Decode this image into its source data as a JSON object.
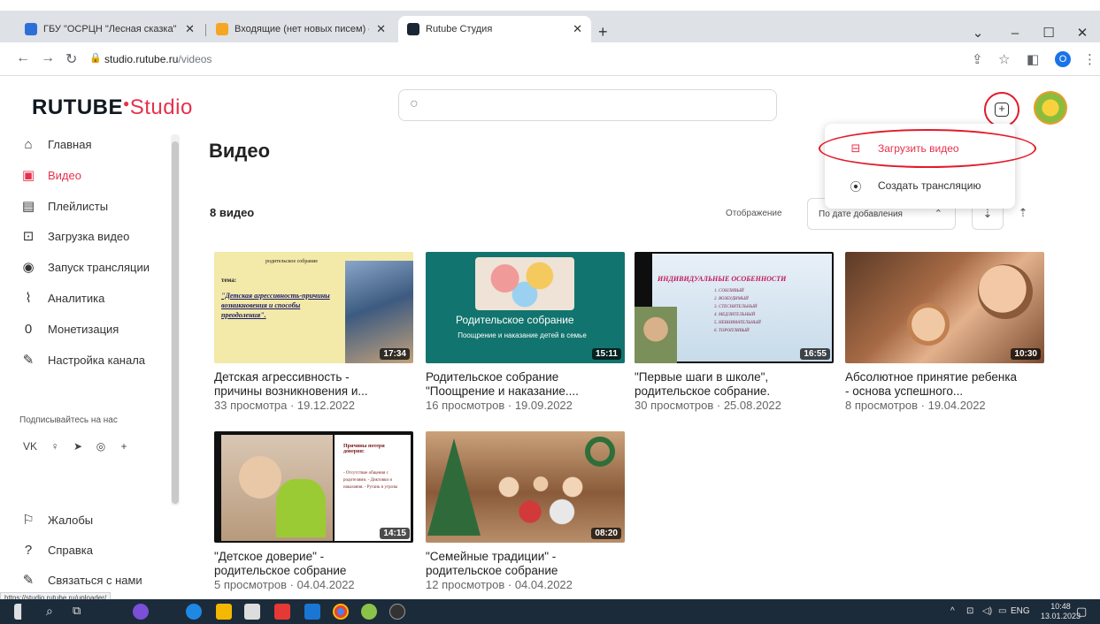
{
  "browser": {
    "tabs": [
      {
        "label": "ГБУ \"ОСРЦН \"Лесная сказка\" (п",
        "favicon_color": "#2d6fd9"
      },
      {
        "label": "Входящие (нет новых писем) —",
        "favicon_color": "#f5a623"
      },
      {
        "label": "Rutube Студия",
        "favicon_color": "#1a2633"
      }
    ],
    "url_host": "studio.rutube.ru",
    "url_path": "/videos",
    "profile_initial": "O",
    "status_url": "https://studio.rutube.ru/uploader/"
  },
  "header": {
    "logo_main": "RUTUBE",
    "logo_studio": "Studio",
    "search_placeholder": ""
  },
  "upload_menu": {
    "items": [
      {
        "label": "Загрузить видео",
        "icon": "upload-video-icon"
      },
      {
        "label": "Создать трансляцию",
        "icon": "broadcast-icon"
      }
    ]
  },
  "sidebar": {
    "items": [
      {
        "label": "Главная",
        "icon": "home-icon"
      },
      {
        "label": "Видео",
        "icon": "video-icon",
        "active": true
      },
      {
        "label": "Плейлисты",
        "icon": "playlist-icon"
      },
      {
        "label": "Загрузка видео",
        "icon": "upload-icon"
      },
      {
        "label": "Запуск трансляции",
        "icon": "broadcast-icon"
      },
      {
        "label": "Аналитика",
        "icon": "analytics-icon"
      },
      {
        "label": "Монетизация",
        "icon": "monetization-icon"
      },
      {
        "label": "Настройка канала",
        "icon": "settings-wand-icon"
      }
    ],
    "subscribe_title": "Подписывайтесь на нас",
    "socials": [
      "vk-icon",
      "ok-icon",
      "telegram-icon",
      "viber-icon",
      "plus-icon"
    ],
    "bottom_items": [
      {
        "label": "Жалобы",
        "icon": "flag-icon"
      },
      {
        "label": "Справка",
        "icon": "help-icon"
      },
      {
        "label": "Связаться с нами",
        "icon": "chat-icon"
      }
    ]
  },
  "main": {
    "title": "Видео",
    "count": "8 видео",
    "display_label": "Отображение",
    "sort_value": "По дате добавления"
  },
  "videos": [
    {
      "title1": "Детская агрессивность -",
      "title2": "причины возникновения и...",
      "meta": "33 просмотра · 19.12.2022",
      "duration": "17:34",
      "thumb_text": {
        "top": "родительское собрание",
        "label": "тема:",
        "body": "\"Детская агрессивность-причины возникновения и способы преодоления\"."
      }
    },
    {
      "title1": "Родительское собрание",
      "title2": "\"Поощрение и наказание....",
      "meta": "16 просмотров · 19.09.2022",
      "duration": "15:11",
      "thumb_text": {
        "title": "Родительское собрание",
        "sub": "Поощрение и наказание детей в семье"
      }
    },
    {
      "title1": "\"Первые шаги в школе\",",
      "title2": "родительское собрание.",
      "meta": "30 просмотров · 25.08.2022",
      "duration": "16:55",
      "thumb_text": {
        "title": "ИНДИВИДУАЛЬНЫЕ ОСОБЕННОСТИ",
        "lines": [
          "1. СОНЛИВЫЙ",
          "2. ВОЗБУДИМЫЙ",
          "3. СТЕСНИТЕЛЬНЫЙ",
          "4. МЕДЛИТЕЛЬНЫЙ",
          "5. НЕВНИМАТЕЛЬНЫЙ",
          "6. ТОРОПЛИВЫЙ"
        ]
      }
    },
    {
      "title1": "Абсолютное принятие ребенка",
      "title2": "- основа успешного...",
      "meta": "8 просмотров · 19.04.2022",
      "duration": "10:30"
    },
    {
      "title1": "\"Детское доверие\" -",
      "title2": "родительское собрание",
      "meta": "5 просмотров · 04.04.2022",
      "duration": "14:15",
      "thumb_text": {
        "title": "Причины потери доверия:",
        "body": "- Отсутствие общения с родителями. - Диктовки и наказания. - Ругань и угрозы"
      }
    },
    {
      "title1": "\"Семейные традиции\" -",
      "title2": "родительское собрание",
      "meta": "12 просмотров · 04.04.2022",
      "duration": "08:20"
    }
  ],
  "taskbar": {
    "lang": "ENG",
    "time": "10:48",
    "date": "13.01.2023"
  },
  "colors": {
    "brand": "#e7314b",
    "highlight": "#e21b2a"
  }
}
